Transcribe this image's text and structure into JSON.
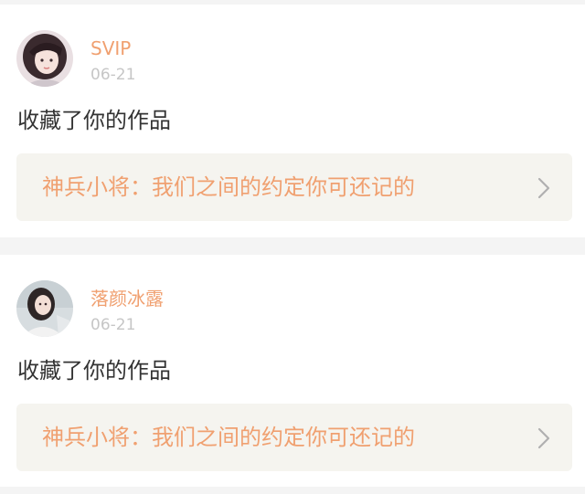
{
  "notifications": [
    {
      "username": "SVIP",
      "date": "06-21",
      "action": "收藏了你的作品",
      "work_title": "神兵小将：我们之间的约定你可还记的"
    },
    {
      "username": "落颜冰露",
      "date": "06-21",
      "action": "收藏了你的作品",
      "work_title": "神兵小将：我们之间的约定你可还记的"
    }
  ],
  "colors": {
    "accent": "#f0a070",
    "date": "#c6c6c6",
    "text": "#333333",
    "link_bg": "#f5f4ef",
    "page_bg": "#f4f4f4",
    "chevron": "#b0b0b0"
  },
  "icons": {
    "avatar": "user-avatar-icon",
    "chevron": "chevron-right-icon"
  }
}
